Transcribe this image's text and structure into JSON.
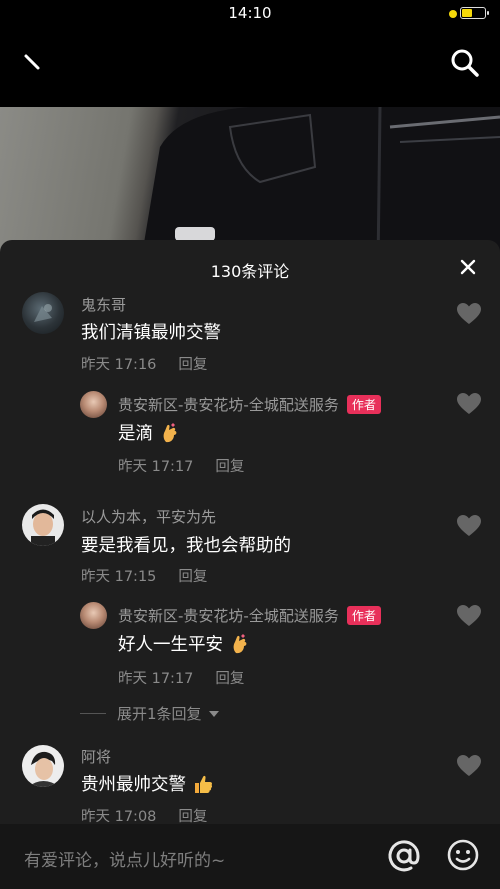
{
  "status": {
    "time": "14:10"
  },
  "sheet": {
    "title": "130条评论"
  },
  "comments": [
    {
      "user": "鬼东哥",
      "text": "我们清镇最帅交警",
      "time": "昨天 17:16",
      "reply_label": "回复"
    },
    {
      "user": "贵安新区-贵安花坊-全城配送服务",
      "badge": "作者",
      "text": "是滴",
      "time": "昨天 17:17",
      "reply_label": "回复"
    },
    {
      "user": "以人为本，平安为先",
      "text": "要是我看见，我也会帮助的",
      "time": "昨天 17:15",
      "reply_label": "回复"
    },
    {
      "user": "贵安新区-贵安花坊-全城配送服务",
      "badge": "作者",
      "text": "好人一生平安",
      "time": "昨天 17:17",
      "reply_label": "回复"
    },
    {
      "user": "阿将",
      "text": "贵州最帅交警",
      "time": "昨天 17:08",
      "reply_label": "回复"
    }
  ],
  "expand_replies": {
    "label": "展开1条回复"
  },
  "input": {
    "placeholder": "有爱评论，说点儿好听的~"
  },
  "icons": {
    "back": "back-icon",
    "search": "search-icon",
    "close": "close-icon",
    "like": "heart-icon",
    "mention": "at-icon",
    "emoji": "emoji-icon",
    "chevron": "chevron-down-icon"
  },
  "colors": {
    "author_badge": "#e8305a",
    "sheet_bg": "#1e1e1e",
    "muted_text": "#8a8a8a"
  }
}
